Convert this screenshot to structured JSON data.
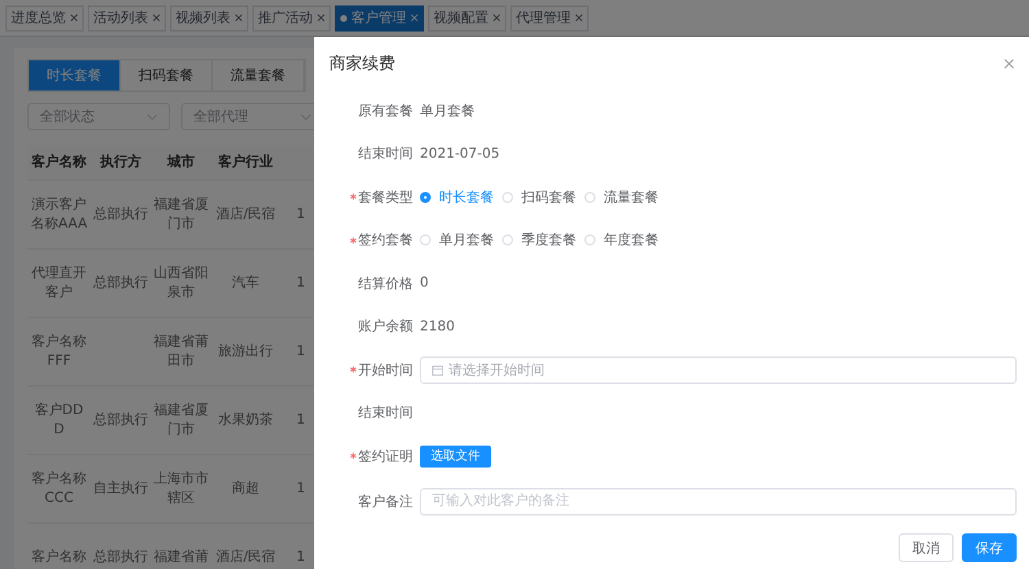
{
  "tags": [
    {
      "label": "进度总览",
      "selected": false
    },
    {
      "label": "活动列表",
      "selected": false
    },
    {
      "label": "视频列表",
      "selected": false
    },
    {
      "label": "推广活动",
      "selected": false
    },
    {
      "label": "客户管理",
      "selected": true
    },
    {
      "label": "视频配置",
      "selected": false
    },
    {
      "label": "代理管理",
      "selected": false
    }
  ],
  "tabs": [
    {
      "label": "时长套餐",
      "selected": true
    },
    {
      "label": "扫码套餐",
      "selected": false
    },
    {
      "label": "流量套餐",
      "selected": false
    }
  ],
  "filters": [
    {
      "placeholder": "全部状态"
    },
    {
      "placeholder": "全部代理"
    }
  ],
  "table": {
    "columns": [
      "客户名称",
      "执行方",
      "城市",
      "客户行业"
    ],
    "rows": [
      {
        "name": "演示客户名称AAA",
        "executor": "总部执行",
        "city": "福建省厦门市",
        "industry": "酒店/民宿",
        "column_5": "1"
      },
      {
        "name": "代理直开客户",
        "executor": "总部执行",
        "city": "山西省阳泉市",
        "industry": "汽车",
        "column_5": "1"
      },
      {
        "name": "客户名称FFF",
        "city": "福建省莆田市",
        "industry": "旅游出行",
        "column_5": "1"
      },
      {
        "name": "客户DDD",
        "executor": "总部执行",
        "city": "福建省厦门市",
        "industry": "水果奶茶",
        "column_5": "1"
      },
      {
        "name": "客户名称CCC",
        "executor": "自主执行",
        "city": "上海市市辖区",
        "industry": "商超",
        "column_5": "1"
      },
      {
        "name": "客户名称",
        "executor": "总部执行",
        "city": "福建省莆",
        "industry": "酒店/民宿",
        "column_5": "1"
      }
    ]
  },
  "drawer": {
    "title": "商家续费",
    "fields": [
      {
        "kind": "text",
        "label": "原有套餐",
        "required": false,
        "value": "单月套餐"
      },
      {
        "kind": "text",
        "label": "结束时间",
        "required": false,
        "value": "2021-07-05"
      },
      {
        "kind": "radio",
        "label": "套餐类型",
        "required": true,
        "options": [
          {
            "label": "时长套餐",
            "selected": true
          },
          {
            "label": "扫码套餐",
            "selected": false
          },
          {
            "label": "流量套餐",
            "selected": false
          }
        ]
      },
      {
        "kind": "radio",
        "label": "签约套餐",
        "required": true,
        "options": [
          {
            "label": "单月套餐",
            "selected": false
          },
          {
            "label": "季度套餐",
            "selected": false
          },
          {
            "label": "年度套餐",
            "selected": false
          }
        ]
      },
      {
        "kind": "text",
        "label": "结算价格",
        "required": false,
        "value": "0"
      },
      {
        "kind": "text",
        "label": "账户余额",
        "required": false,
        "value": "2180"
      },
      {
        "kind": "date",
        "label": "开始时间",
        "required": true,
        "placeholder": "请选择开始时间"
      },
      {
        "kind": "text",
        "label": "结束时间",
        "required": false
      },
      {
        "kind": "upload",
        "label": "签约证明",
        "required": true,
        "button": "选取文件"
      },
      {
        "kind": "input",
        "label": "客户备注",
        "required": false,
        "placeholder": "可输入对此客户的备注"
      }
    ],
    "buttons": [
      {
        "kind": "default",
        "label": "取消"
      },
      {
        "kind": "primary",
        "label": "保存"
      }
    ]
  }
}
